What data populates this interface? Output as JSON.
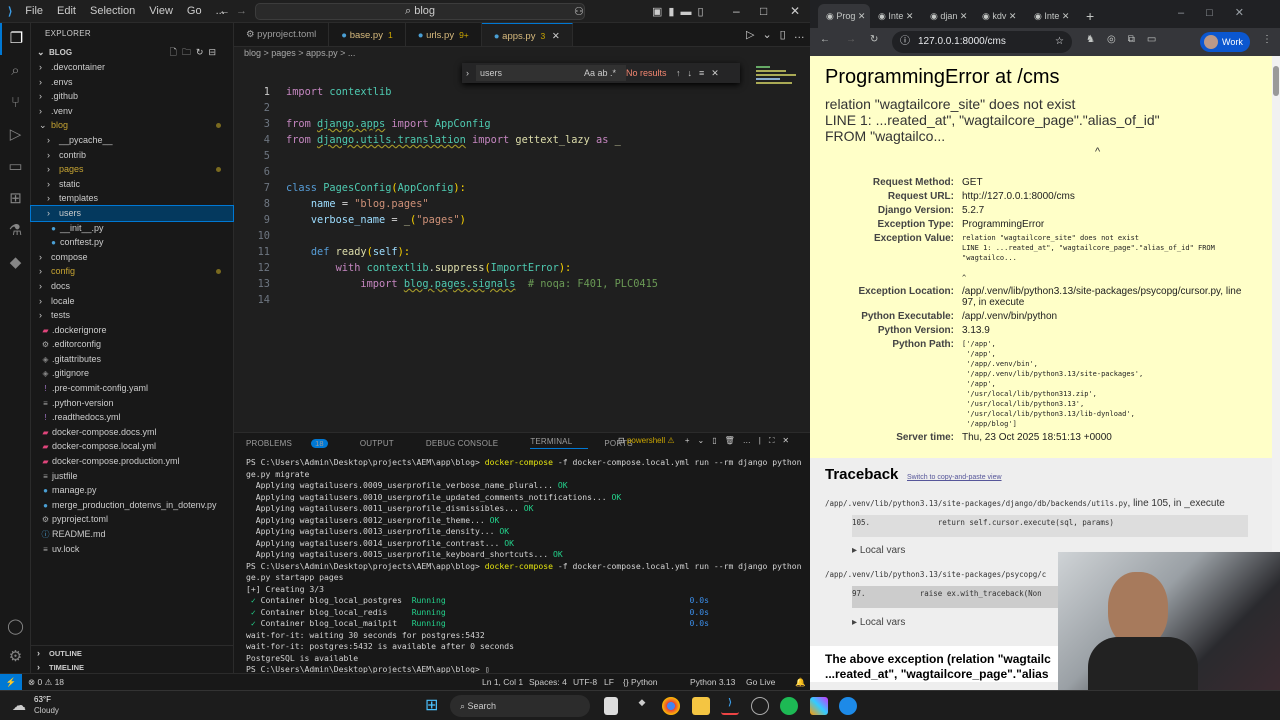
{
  "vscode": {
    "menu": [
      "File",
      "Edit",
      "Selection",
      "View",
      "Go",
      "..."
    ],
    "command_center": "blog",
    "explorer_title": "EXPLORER",
    "root": "BLOG",
    "tree": [
      {
        "label": ".devcontainer",
        "type": "folder",
        "depth": 0
      },
      {
        "label": ".envs",
        "type": "folder",
        "depth": 0
      },
      {
        "label": ".github",
        "type": "folder",
        "depth": 0
      },
      {
        "label": ".venv",
        "type": "folder",
        "depth": 0
      },
      {
        "label": "blog",
        "type": "folder-open",
        "depth": 0,
        "modified": true
      },
      {
        "label": "__pycache__",
        "type": "folder",
        "depth": 1
      },
      {
        "label": "contrib",
        "type": "folder",
        "depth": 1
      },
      {
        "label": "pages",
        "type": "folder",
        "depth": 1,
        "modified": true
      },
      {
        "label": "static",
        "type": "folder",
        "depth": 1
      },
      {
        "label": "templates",
        "type": "folder",
        "depth": 1
      },
      {
        "label": "users",
        "type": "folder",
        "depth": 1,
        "selected": true
      },
      {
        "label": "__init__.py",
        "type": "py",
        "depth": 1
      },
      {
        "label": "conftest.py",
        "type": "py",
        "depth": 1
      },
      {
        "label": "compose",
        "type": "folder",
        "depth": 0
      },
      {
        "label": "config",
        "type": "folder",
        "depth": 0,
        "modified": true
      },
      {
        "label": "docs",
        "type": "folder",
        "depth": 0
      },
      {
        "label": "locale",
        "type": "folder",
        "depth": 0
      },
      {
        "label": "tests",
        "type": "folder",
        "depth": 0
      },
      {
        "label": ".dockerignore",
        "type": "docker",
        "depth": 0
      },
      {
        "label": ".editorconfig",
        "type": "gear",
        "depth": 0
      },
      {
        "label": ".gitattributes",
        "type": "git",
        "depth": 0
      },
      {
        "label": ".gitignore",
        "type": "git",
        "depth": 0
      },
      {
        "label": ".pre-commit-config.yaml",
        "type": "yaml",
        "depth": 0
      },
      {
        "label": ".python-version",
        "type": "text",
        "depth": 0
      },
      {
        "label": ".readthedocs.yml",
        "type": "yaml",
        "depth": 0
      },
      {
        "label": "docker-compose.docs.yml",
        "type": "docker",
        "depth": 0
      },
      {
        "label": "docker-compose.local.yml",
        "type": "docker",
        "depth": 0
      },
      {
        "label": "docker-compose.production.yml",
        "type": "docker",
        "depth": 0
      },
      {
        "label": "justfile",
        "type": "text",
        "depth": 0
      },
      {
        "label": "manage.py",
        "type": "py",
        "depth": 0
      },
      {
        "label": "merge_production_dotenvs_in_dotenv.py",
        "type": "py",
        "depth": 0
      },
      {
        "label": "pyproject.toml",
        "type": "gear",
        "depth": 0
      },
      {
        "label": "README.md",
        "type": "info",
        "depth": 0
      },
      {
        "label": "uv.lock",
        "type": "text",
        "depth": 0
      }
    ],
    "outline": "OUTLINE",
    "timeline": "TIMELINE",
    "tabs": [
      {
        "label": "pyproject.toml",
        "badge": "",
        "icon": "gear"
      },
      {
        "label": "base.py",
        "badge": "1",
        "icon": "py"
      },
      {
        "label": "urls.py",
        "badge": "9+",
        "icon": "py"
      },
      {
        "label": "apps.py",
        "badge": "3",
        "icon": "py",
        "active": true
      }
    ],
    "breadcrumb": "blog > pages > apps.py > ...",
    "find": {
      "value": "users",
      "options": "Aa ab .*",
      "result": "No results"
    },
    "code": [
      [
        [
          "k",
          "import"
        ],
        [
          "p",
          " "
        ],
        [
          "m2",
          "contextlib"
        ]
      ],
      [],
      [
        [
          "k",
          "from"
        ],
        [
          "p",
          " "
        ],
        [
          "m2 u",
          "django.apps"
        ],
        [
          "p",
          " "
        ],
        [
          "k",
          "import"
        ],
        [
          "p",
          " "
        ],
        [
          "m2",
          "AppConfig"
        ]
      ],
      [
        [
          "k",
          "from"
        ],
        [
          "p",
          " "
        ],
        [
          "m2 u",
          "django.utils.translation"
        ],
        [
          "p",
          " "
        ],
        [
          "k",
          "import"
        ],
        [
          "p",
          " "
        ],
        [
          "f",
          "gettext_lazy"
        ],
        [
          "p",
          " "
        ],
        [
          "k",
          "as"
        ],
        [
          "p",
          " "
        ],
        [
          "f",
          "_"
        ]
      ],
      [],
      [],
      [
        [
          "d",
          "class"
        ],
        [
          "p",
          " "
        ],
        [
          "m2",
          "PagesConfig"
        ],
        [
          "y",
          "("
        ],
        [
          "m2",
          "AppConfig"
        ],
        [
          "y",
          "):"
        ]
      ],
      [
        [
          "p",
          "    "
        ],
        [
          "v",
          "name"
        ],
        [
          "p",
          " = "
        ],
        [
          "s",
          "\"blog.pages\""
        ]
      ],
      [
        [
          "p",
          "    "
        ],
        [
          "v",
          "verbose_name"
        ],
        [
          "p",
          " = "
        ],
        [
          "f",
          "_"
        ],
        [
          "y",
          "("
        ],
        [
          "s",
          "\"pages\""
        ],
        [
          "y",
          ")"
        ]
      ],
      [],
      [
        [
          "p",
          "    "
        ],
        [
          "d",
          "def"
        ],
        [
          "p",
          " "
        ],
        [
          "f",
          "ready"
        ],
        [
          "y",
          "("
        ],
        [
          "v",
          "self"
        ],
        [
          "y",
          "):"
        ]
      ],
      [
        [
          "p",
          "        "
        ],
        [
          "k",
          "with"
        ],
        [
          "p",
          " "
        ],
        [
          "m2",
          "contextlib"
        ],
        [
          "p",
          "."
        ],
        [
          "f",
          "suppress"
        ],
        [
          "y",
          "("
        ],
        [
          "m2",
          "ImportError"
        ],
        [
          "y",
          "):"
        ]
      ],
      [
        [
          "p",
          "            "
        ],
        [
          "k",
          "import"
        ],
        [
          "p",
          " "
        ],
        [
          "m2 u",
          "blog.pages.signals"
        ],
        [
          "p",
          "  "
        ],
        [
          "c",
          "# noqa: F401, PLC0415"
        ]
      ],
      []
    ],
    "panel_tabs": [
      "PROBLEMS",
      "OUTPUT",
      "DEBUG CONSOLE",
      "TERMINAL",
      "PORTS"
    ],
    "problems_count": "18",
    "shell": "powershell",
    "terminal": [
      [
        [
          "p",
          "PS C:\\Users\\Admin\\Desktop\\projects\\AEM\\app\\blog> "
        ],
        [
          "yc",
          "docker-compose"
        ],
        [
          "p",
          " -f docker-compose.local.yml run --rm django python mana"
        ]
      ],
      [
        [
          "p",
          "ge.py migrate"
        ]
      ],
      [
        [
          "p",
          "  Applying wagtailusers.0009_userprofile_verbose_name_plural... "
        ],
        [
          "ok",
          "OK"
        ]
      ],
      [
        [
          "p",
          "  Applying wagtailusers.0010_userprofile_updated_comments_notifications... "
        ],
        [
          "ok",
          "OK"
        ]
      ],
      [
        [
          "p",
          "  Applying wagtailusers.0011_userprofile_dismissibles... "
        ],
        [
          "ok",
          "OK"
        ]
      ],
      [
        [
          "p",
          "  Applying wagtailusers.0012_userprofile_theme... "
        ],
        [
          "ok",
          "OK"
        ]
      ],
      [
        [
          "p",
          "  Applying wagtailusers.0013_userprofile_density... "
        ],
        [
          "ok",
          "OK"
        ]
      ],
      [
        [
          "p",
          "  Applying wagtailusers.0014_userprofile_contrast... "
        ],
        [
          "ok",
          "OK"
        ]
      ],
      [
        [
          "p",
          "  Applying wagtailusers.0015_userprofile_keyboard_shortcuts... "
        ],
        [
          "ok",
          "OK"
        ]
      ],
      [
        [
          "p",
          "PS C:\\Users\\Admin\\Desktop\\projects\\AEM\\app\\blog> "
        ],
        [
          "yc",
          "docker-compose"
        ],
        [
          "p",
          " -f docker-compose.local.yml run --rm django python mana"
        ]
      ],
      [
        [
          "p",
          "ge.py startapp pages"
        ]
      ],
      [
        [
          "p",
          "[+] Creating 3/3"
        ]
      ],
      [
        [
          "ok",
          " ✓ "
        ],
        [
          "p",
          "Container blog_local_postgres  "
        ],
        [
          "ok",
          "Running"
        ],
        [
          "bl",
          "                                                  0.0s"
        ]
      ],
      [
        [
          "ok",
          " ✓ "
        ],
        [
          "p",
          "Container blog_local_redis     "
        ],
        [
          "ok",
          "Running"
        ],
        [
          "bl",
          "                                                  0.0s"
        ]
      ],
      [
        [
          "ok",
          " ✓ "
        ],
        [
          "p",
          "Container blog_local_mailpit   "
        ],
        [
          "ok",
          "Running"
        ],
        [
          "bl",
          "                                                  0.0s"
        ]
      ],
      [
        [
          "p",
          "wait-for-it: waiting 30 seconds for postgres:5432"
        ]
      ],
      [
        [
          "p",
          "wait-for-it: postgres:5432 is available after 0 seconds"
        ]
      ],
      [
        [
          "p",
          "PostgreSQL is available"
        ]
      ],
      [
        [
          "p",
          "PS C:\\Users\\Admin\\Desktop\\projects\\AEM\\app\\blog> ▯"
        ]
      ]
    ],
    "status": {
      "errors": "0",
      "warnings": "18",
      "position": "Ln 1, Col 1",
      "spaces": "Spaces: 4",
      "encoding": "UTF-8",
      "eol": "LF",
      "language": "{} Python",
      "interpreter": "Python 3.13",
      "golive": "Go Live"
    }
  },
  "browser": {
    "tabs": [
      "Prog",
      "Inte",
      "djan",
      "kdv",
      "Inte"
    ],
    "url": "127.0.0.1:8000/cms",
    "profile": "Work",
    "page": {
      "title": "ProgrammingError at /cms",
      "summary": [
        "relation \"wagtailcore_site\" does not exist",
        "LINE 1: ...reated_at\", \"wagtailcore_page\".\"alias_of_id\"",
        "FROM \"wagtailco...",
        "^"
      ],
      "meta": [
        {
          "k": "Request Method:",
          "v": "GET"
        },
        {
          "k": "Request URL:",
          "v": "http://127.0.0.1:8000/cms"
        },
        {
          "k": "Django Version:",
          "v": "5.2.7"
        },
        {
          "k": "Exception Type:",
          "v": "ProgrammingError"
        },
        {
          "k": "Exception Value:",
          "v": "relation \"wagtailcore_site\" does not exist\nLINE 1: ...reated_at\", \"wagtailcore_page\".\"alias_of_id\" FROM\n\"wagtailco...\n\n^",
          "mono": true
        },
        {
          "k": "Exception Location:",
          "v": "/app/.venv/lib/python3.13/site-packages/psycopg/cursor.py, line 97, in execute"
        },
        {
          "k": "Python Executable:",
          "v": "/app/.venv/bin/python"
        },
        {
          "k": "Python Version:",
          "v": "3.13.9"
        },
        {
          "k": "Python Path:",
          "v": "['/app',\n '/app',\n '/app/.venv/bin',\n '/app/.venv/lib/python3.13/site-packages',\n '/app',\n '/usr/local/lib/python313.zip',\n '/usr/local/lib/python3.13',\n '/usr/local/lib/python3.13/lib-dynload',\n '/app/blog']",
          "mono": true
        },
        {
          "k": "Server time:",
          "v": "Thu, 23 Oct 2025 18:51:13 +0000"
        }
      ],
      "traceback_title": "Traceback",
      "switch_link": "Switch to copy-and-paste view",
      "frames": [
        {
          "file": "/app/.venv/lib/python3.13/site-packages/django/db/backends/utils.py",
          "loc": ", line 105, in _execute",
          "lineno": "105.",
          "code": "               return self.cursor.execute(sql, params)",
          "local_vars": "Local vars"
        },
        {
          "file": "/app/.venv/lib/python3.13/site-packages/psycopg/c",
          "loc": "",
          "lineno": "97.",
          "code": "            raise ex.with_traceback(Non",
          "local_vars": "Local vars"
        }
      ],
      "above": [
        "The above exception (relation \"wagtailc",
        "...reated_at\", \"wagtailcore_page\".\"alias"
      ]
    }
  },
  "taskbar": {
    "weather_temp": "63°F",
    "weather_desc": "Cloudy",
    "search": "Search"
  }
}
